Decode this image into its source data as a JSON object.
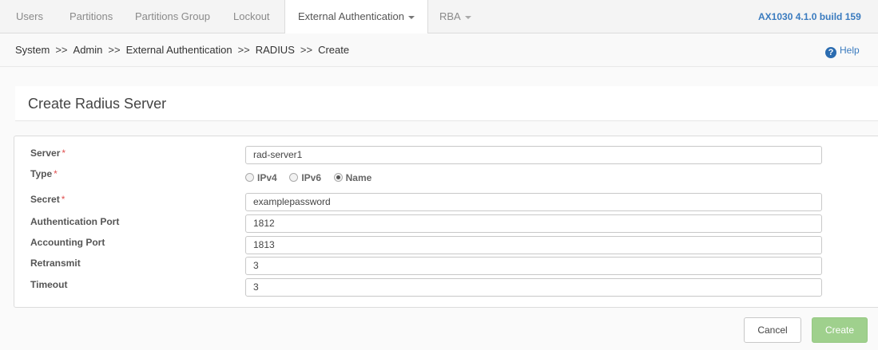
{
  "nav": {
    "tabs": [
      {
        "label": "Users"
      },
      {
        "label": "Partitions"
      },
      {
        "label": "Partitions Group"
      },
      {
        "label": "Lockout"
      },
      {
        "label": "External Authentication"
      },
      {
        "label": "RBA"
      }
    ],
    "active_tab": "External Authentication",
    "version": "AX1030 4.1.0 build 159"
  },
  "breadcrumb": {
    "items": [
      "System",
      "Admin",
      "External Authentication",
      "RADIUS",
      "Create"
    ],
    "separator": ">>"
  },
  "help": {
    "label": "Help",
    "icon": "question-circle-icon"
  },
  "page": {
    "title": "Create Radius Server"
  },
  "form": {
    "required_marker": "*",
    "server": {
      "label": "Server",
      "value": "rad-server1"
    },
    "type": {
      "label": "Type",
      "options": [
        "IPv4",
        "IPv6",
        "Name"
      ],
      "selected": "Name"
    },
    "secret": {
      "label": "Secret",
      "value": "examplepassword"
    },
    "auth_port": {
      "label": "Authentication Port",
      "value": "1812"
    },
    "acct_port": {
      "label": "Accounting Port",
      "value": "1813"
    },
    "retransmit": {
      "label": "Retransmit",
      "value": "3"
    },
    "timeout": {
      "label": "Timeout",
      "value": "3"
    }
  },
  "actions": {
    "cancel": "Cancel",
    "create": "Create"
  },
  "colors": {
    "accent": "#3a7bbf",
    "create_button": "#9fd08d",
    "required": "#e05050"
  }
}
